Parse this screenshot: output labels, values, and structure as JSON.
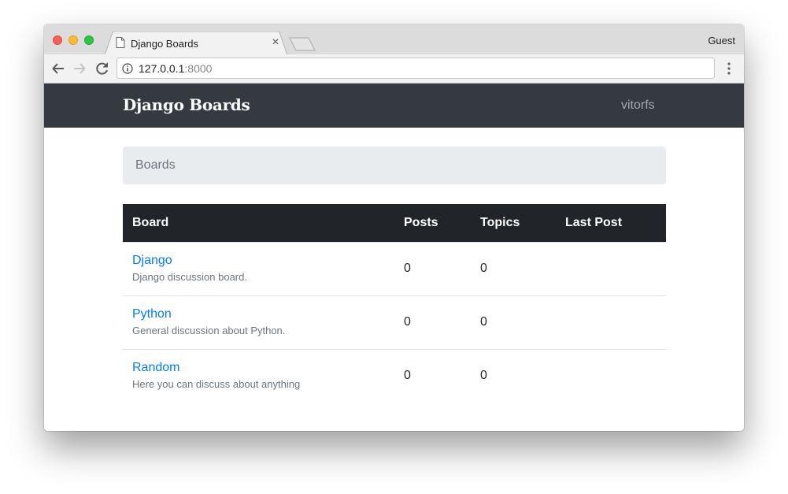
{
  "browser": {
    "tab_title": "Django Boards",
    "tab_close": "×",
    "profile": "Guest",
    "url_host": "127.0.0.1",
    "url_port": ":8000",
    "icons": [
      "back-icon",
      "forward-icon",
      "reload-icon",
      "info-icon",
      "menu-icon",
      "document-icon",
      "close-icon"
    ]
  },
  "navbar": {
    "brand": "Django Boards",
    "user": "vitorfs",
    "background": "#343a40"
  },
  "breadcrumb": {
    "items": [
      "Boards"
    ]
  },
  "table": {
    "headers": [
      "Board",
      "Posts",
      "Topics",
      "Last Post"
    ],
    "rows": [
      {
        "name": "Django",
        "description": "Django discussion board.",
        "posts": "0",
        "topics": "0",
        "last_post": ""
      },
      {
        "name": "Python",
        "description": "General discussion about Python.",
        "posts": "0",
        "topics": "0",
        "last_post": ""
      },
      {
        "name": "Random",
        "description": "Here you can discuss about anything",
        "posts": "0",
        "topics": "0",
        "last_post": ""
      }
    ]
  },
  "colors": {
    "link": "#007bff",
    "table_header": "#212529",
    "breadcrumb_bg": "#e9ecef"
  }
}
